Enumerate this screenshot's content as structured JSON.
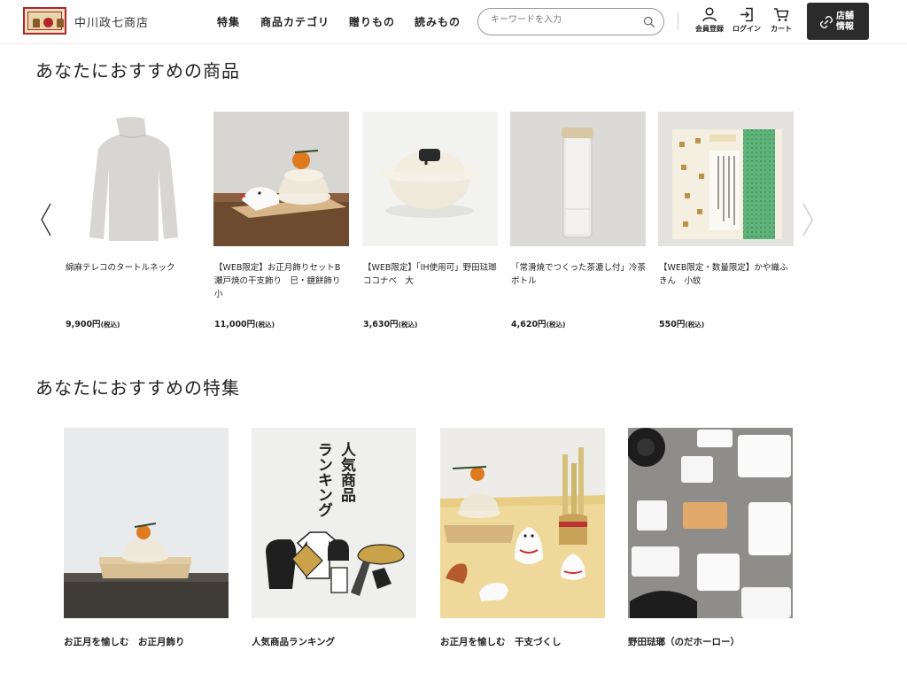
{
  "header": {
    "brand": "中川政七商店",
    "nav": [
      "特集",
      "商品カテゴリ",
      "贈りもの",
      "読みもの"
    ],
    "search_placeholder": "キーワードを入力",
    "icons": [
      {
        "label": "会員登録",
        "icon": "user-icon"
      },
      {
        "label": "ログイン",
        "icon": "login-icon"
      },
      {
        "label": "カート",
        "icon": "cart-icon"
      }
    ],
    "store_button": {
      "line1": "店舗",
      "line2": "情報",
      "icon": "store-link-icon"
    }
  },
  "recommended_products": {
    "title": "あなたにおすすめの商品",
    "items": [
      {
        "name": "綿麻テレコのタートルネック",
        "price": "9,900円",
        "tax": "(税込)"
      },
      {
        "name": "【WEB限定】お正月飾りセットB　瀬戸焼の干支飾り　巳・鏡餅飾り　小",
        "price": "11,000円",
        "tax": "(税込)"
      },
      {
        "name": "【WEB限定】「IH使用可」野田琺瑯　ココナベ　大",
        "price": "3,630円",
        "tax": "(税込)"
      },
      {
        "name": "「常滑焼でつくった茶漉し付」冷茶ボトル",
        "price": "4,620円",
        "tax": "(税込)"
      },
      {
        "name": "【WEB限定・数量限定】かや織ふきん　小紋",
        "price": "550円",
        "tax": "(税込)"
      }
    ]
  },
  "recommended_features": {
    "title": "あなたにおすすめの特集",
    "items": [
      {
        "title": "お正月を愉しむ　お正月飾り"
      },
      {
        "title": "人気商品ランキング",
        "image_text": [
          "人気商品",
          "ランキング"
        ]
      },
      {
        "title": "お正月を愉しむ　干支づくし"
      },
      {
        "title": "野田琺瑯（のだホーロー）"
      }
    ]
  },
  "colors": {
    "accent_dark": "#2b2b2b",
    "logo_red": "#b0262a"
  }
}
